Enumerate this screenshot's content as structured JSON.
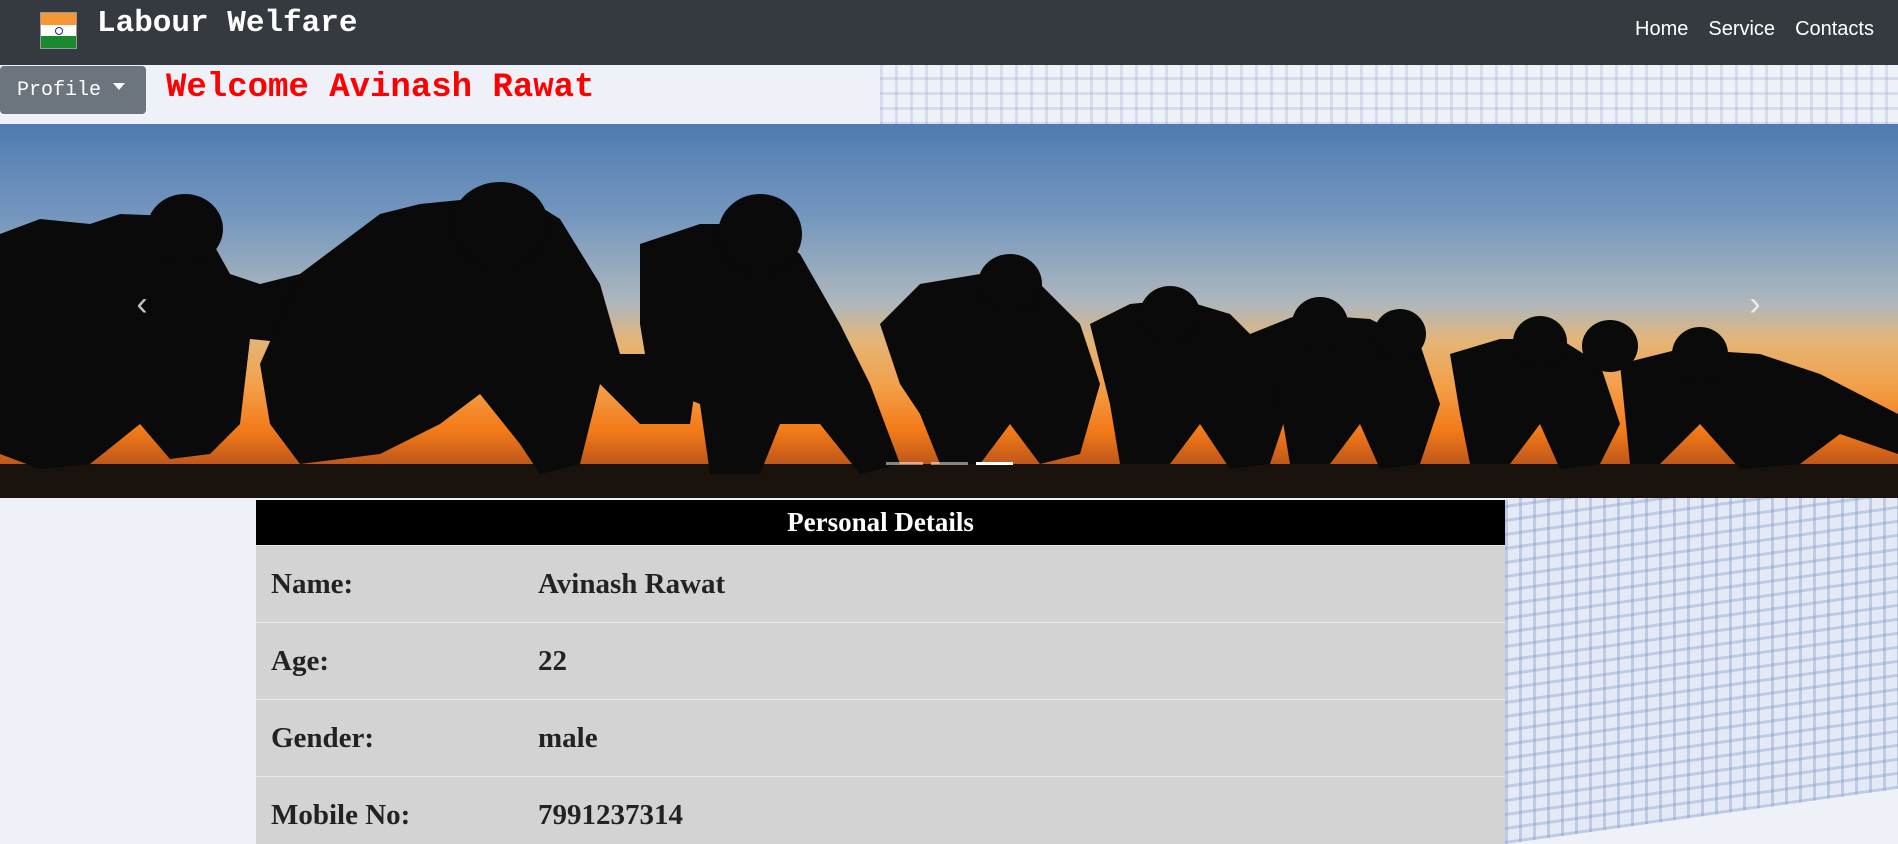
{
  "navbar": {
    "brand": "Labour Welfare",
    "links": [
      "Home",
      "Service",
      "Contacts"
    ]
  },
  "profile": {
    "button_label": "Profile",
    "welcome": "Welcome Avinash Rawat"
  },
  "carousel": {
    "prev_icon": "‹",
    "next_icon": "›",
    "slide_count": 3,
    "active_slide": 3
  },
  "details": {
    "title": "Personal Details",
    "rows": [
      {
        "label": "Name:",
        "value": "Avinash Rawat"
      },
      {
        "label": "Age:",
        "value": "22"
      },
      {
        "label": "Gender:",
        "value": "male"
      },
      {
        "label": "Mobile No:",
        "value": "7991237314"
      }
    ]
  },
  "colors": {
    "navbar_bg": "#343a40",
    "welcome_text": "#ff0000",
    "profile_button": "#6c757d",
    "table_header_bg": "#000000",
    "table_body_bg": "#d3d3d3"
  }
}
